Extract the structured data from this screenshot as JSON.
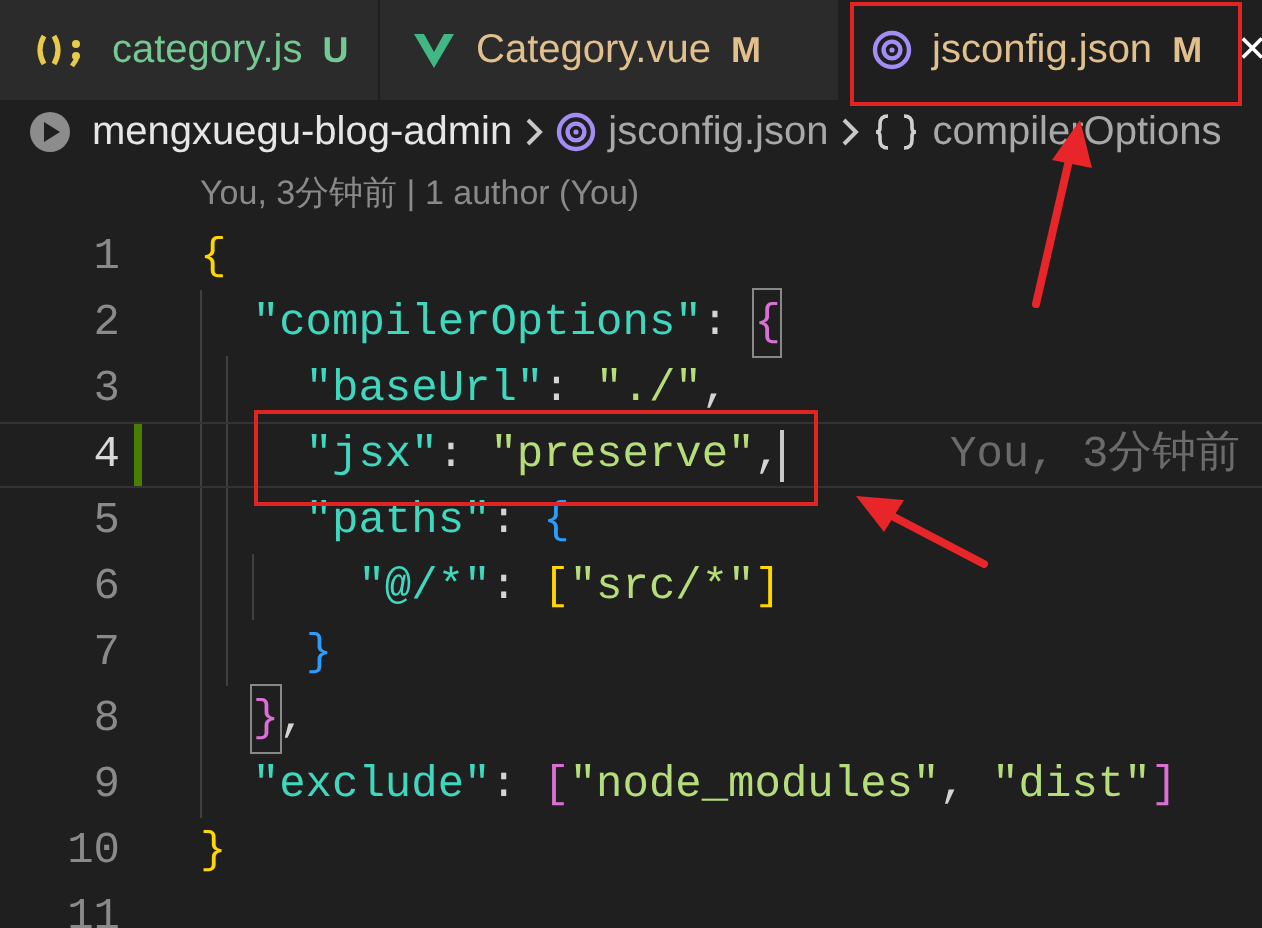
{
  "tabs": [
    {
      "kind": "js",
      "label": "category.js",
      "color": "#73c991",
      "badge": "U",
      "selected": false
    },
    {
      "kind": "vue",
      "label": "Category.vue",
      "color": "#e2c08d",
      "badge": "M",
      "selected": false
    },
    {
      "kind": "json",
      "label": "jsconfig.json",
      "color": "#e2c08d",
      "badge": "M",
      "selected": true,
      "close": "×"
    }
  ],
  "breadcrumb": [
    {
      "kind": "folder",
      "label": "mengxuegu-blog-admin"
    },
    {
      "kind": "file",
      "label": "jsconfig.json"
    },
    {
      "kind": "symbol",
      "label": "compilerOptions"
    }
  ],
  "codelens": "You, 3分钟前 | 1 author (You)",
  "lines": [
    {
      "number": "1",
      "tokens": [
        {
          "kind": "gold",
          "text": "{"
        }
      ]
    },
    {
      "number": "2",
      "tokens": [
        {
          "kind": "key",
          "text": "\"compilerOptions\""
        },
        {
          "kind": "punct",
          "text": ": "
        },
        {
          "kind": "orchid",
          "text": "{",
          "matched": true
        }
      ]
    },
    {
      "number": "3",
      "tokens": [
        {
          "kind": "key",
          "text": "\"baseUrl\""
        },
        {
          "kind": "punct",
          "text": ": "
        },
        {
          "kind": "string",
          "text": "\"./\""
        },
        {
          "kind": "punct",
          "text": ","
        }
      ]
    },
    {
      "number": "4",
      "current": true,
      "changed": true,
      "blame": "You, 3分钟前",
      "tokens": [
        {
          "kind": "key",
          "text": "\"jsx\""
        },
        {
          "kind": "punct",
          "text": ": "
        },
        {
          "kind": "string",
          "text": "\"preserve\""
        },
        {
          "kind": "punct",
          "text": ","
        }
      ]
    },
    {
      "number": "5",
      "tokens": [
        {
          "kind": "key",
          "text": "\"paths\""
        },
        {
          "kind": "punct",
          "text": ": "
        },
        {
          "kind": "blue",
          "text": "{"
        }
      ]
    },
    {
      "number": "6",
      "tokens": [
        {
          "kind": "key",
          "text": "\"@/*\""
        },
        {
          "kind": "punct",
          "text": ": "
        },
        {
          "kind": "gold",
          "text": "["
        },
        {
          "kind": "string",
          "text": "\"src/*\""
        },
        {
          "kind": "gold",
          "text": "]"
        }
      ]
    },
    {
      "number": "7",
      "tokens": [
        {
          "kind": "blue",
          "text": "}"
        }
      ]
    },
    {
      "number": "8",
      "tokens": [
        {
          "kind": "orchid",
          "text": "}",
          "matched": true
        },
        {
          "kind": "punct",
          "text": ","
        }
      ]
    },
    {
      "number": "9",
      "tokens": [
        {
          "kind": "key",
          "text": "\"exclude\""
        },
        {
          "kind": "punct",
          "text": ": "
        },
        {
          "kind": "orchid",
          "text": "["
        },
        {
          "kind": "string",
          "text": "\"node_modules\""
        },
        {
          "kind": "punct",
          "text": ", "
        },
        {
          "kind": "string",
          "text": "\"dist\""
        },
        {
          "kind": "orchid",
          "text": "]"
        }
      ]
    },
    {
      "number": "10",
      "tokens": [
        {
          "kind": "gold",
          "text": "}"
        }
      ]
    },
    {
      "number": "11"
    }
  ]
}
